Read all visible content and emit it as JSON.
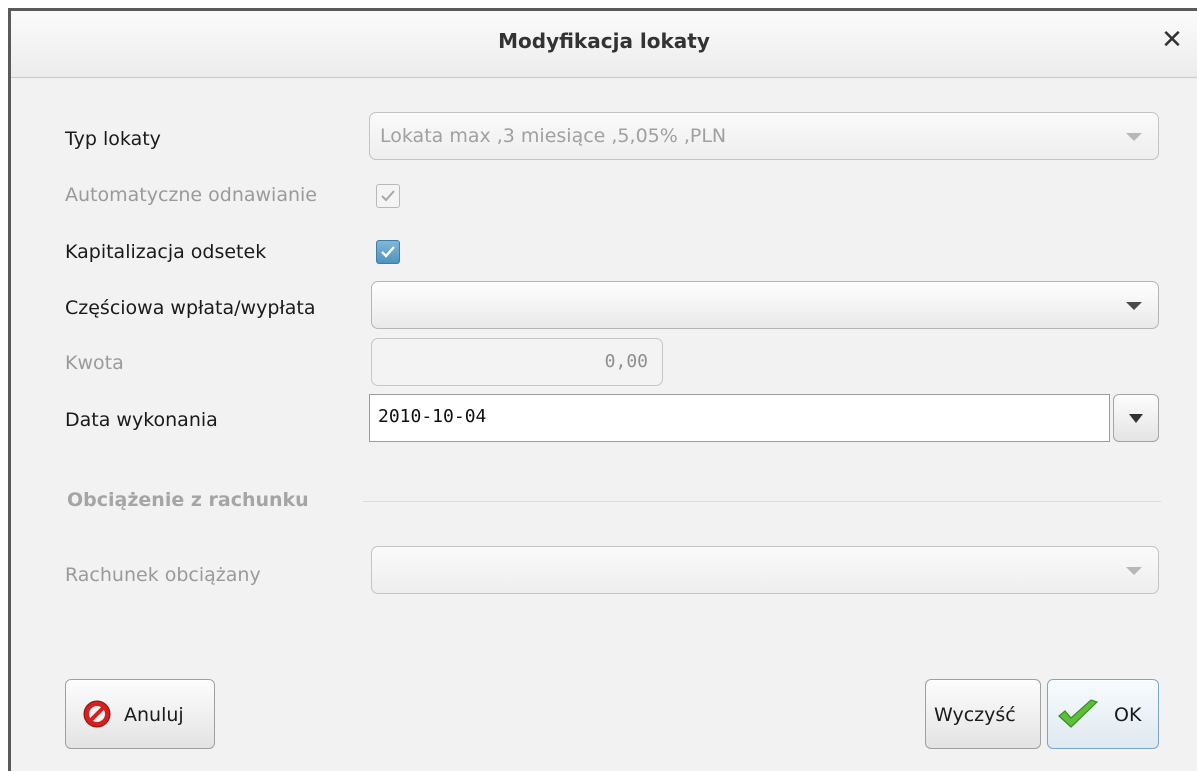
{
  "dialog": {
    "title": "Modyfikacja lokaty",
    "close_symbol": "✕"
  },
  "form": {
    "typ_lokaty": {
      "label": "Typ lokaty",
      "value": "Lokata max ,3 miesiące ,5,05% ,PLN",
      "enabled": false
    },
    "auto_renew": {
      "label": "Automatyczne odnawianie",
      "checked": true,
      "enabled": false
    },
    "capitalization": {
      "label": "Kapitalizacja odsetek",
      "checked": true,
      "enabled": true
    },
    "partial": {
      "label": "Częściowa wpłata/wypłata",
      "value": "",
      "enabled": true
    },
    "amount": {
      "label": "Kwota",
      "value": "0,00",
      "enabled": false
    },
    "execution_date": {
      "label": "Data wykonania",
      "value": "2010-10-04"
    },
    "section": {
      "title": "Obciążenie z rachunku"
    },
    "debit_account": {
      "label": "Rachunek obciążany",
      "value": "",
      "enabled": false
    }
  },
  "buttons": {
    "cancel": "Anuluj",
    "clear": "Wyczyść",
    "ok": "OK"
  },
  "icons": {
    "cancel": "cancel-icon",
    "ok": "checkmark-icon",
    "close": "close-icon",
    "dropdown": "chevron-down-icon"
  }
}
